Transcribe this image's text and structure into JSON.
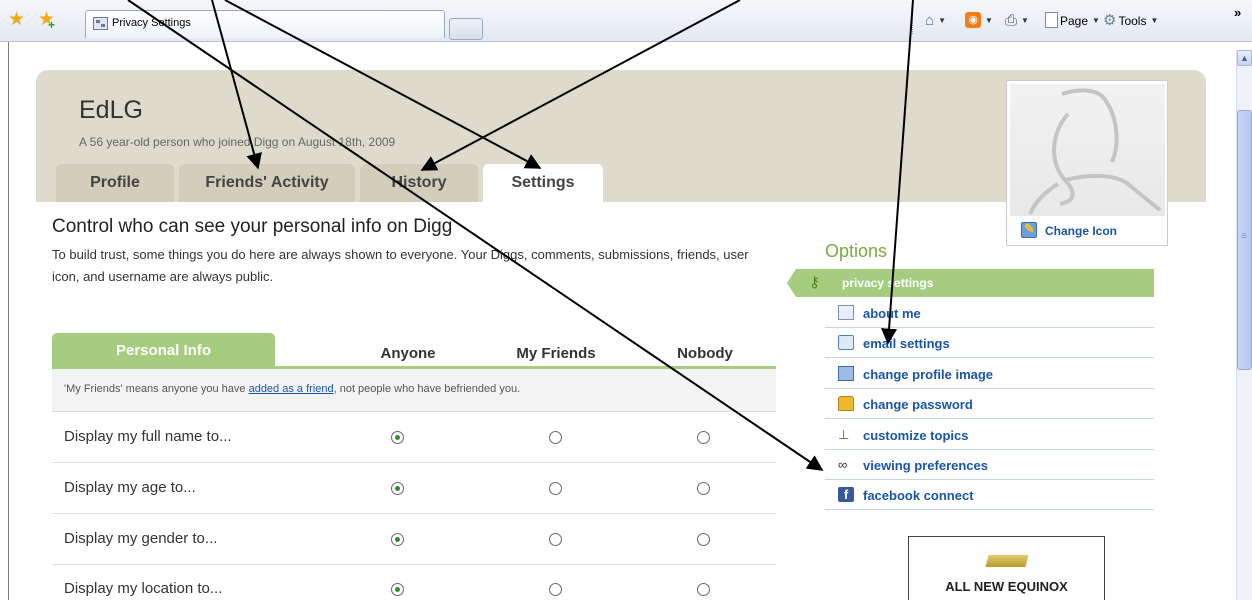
{
  "browser": {
    "tab_title": "Privacy Settings",
    "commands": {
      "page": "Page",
      "tools": "Tools",
      "more": "»"
    }
  },
  "profile": {
    "name": "EdLG",
    "subtitle": "A 56 year-old person who joined Digg on August 18th, 2009",
    "tabs": [
      "Profile",
      "Friends' Activity",
      "History",
      "Settings"
    ],
    "active_tab": "Settings",
    "change_icon_label": "Change Icon"
  },
  "main": {
    "heading": "Control who can see your personal info on Digg",
    "intro": "To build trust, some things you do here are always shown to everyone. Your Diggs, comments, submissions, friends, user icon, and username are always public."
  },
  "privacy_table": {
    "section_tab": "Personal Info",
    "columns": [
      "Anyone",
      "My Friends",
      "Nobody"
    ],
    "note_prefix": "'My Friends' means anyone you have ",
    "note_link": "added as a friend",
    "note_suffix": ", not people who have befriended you.",
    "rows": [
      {
        "label": "Display my full name to...",
        "selected": "Anyone"
      },
      {
        "label": "Display my age to...",
        "selected": "Anyone"
      },
      {
        "label": "Display my gender to...",
        "selected": "Anyone"
      },
      {
        "label": "Display my location to...",
        "selected": "Anyone"
      }
    ]
  },
  "options": {
    "title": "Options",
    "active": {
      "label": "privacy settings",
      "icon": "key-icon"
    },
    "items": [
      {
        "label": "about me",
        "icon": "id-card-icon"
      },
      {
        "label": "email settings",
        "icon": "envelope-icon"
      },
      {
        "label": "change profile image",
        "icon": "image-icon"
      },
      {
        "label": "change password",
        "icon": "lock-icon"
      },
      {
        "label": "customize topics",
        "icon": "sitemap-icon"
      },
      {
        "label": "viewing preferences",
        "icon": "binoculars-icon"
      },
      {
        "label": "facebook connect",
        "icon": "facebook-icon"
      }
    ]
  },
  "ad": {
    "text": "ALL NEW EQUINOX"
  },
  "colors": {
    "accent_green": "#a6cc80",
    "link_blue": "#1a55a8",
    "header_beige": "#dedbcc",
    "selected_radio": "#2f8b2f"
  }
}
